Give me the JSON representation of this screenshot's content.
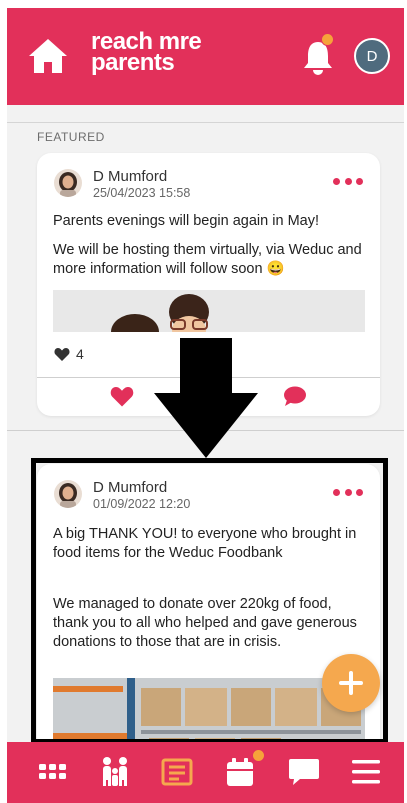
{
  "app": {
    "logo_line1": "reach m",
    "logo_line1_tail": "re",
    "logo_line2": "parents"
  },
  "header": {
    "user_initial": "D"
  },
  "feed": {
    "section_label": "FEATURED",
    "posts": [
      {
        "author": "D Mumford",
        "datetime": "25/04/2023 15:58",
        "paragraphs": [
          "Parents evenings will begin again in May!",
          "We will be hosting them virtually, via Weduc and more information will follow soon 😀"
        ],
        "likes": "4"
      },
      {
        "author": "D Mumford",
        "datetime": "01/09/2022 12:20",
        "paragraphs": [
          "A big THANK YOU! to everyone who brought in food items for the Weduc Foodbank",
          "We managed to donate over 220kg of food, thank you to all who helped and gave generous donations to those that are in crisis."
        ]
      }
    ]
  },
  "nav": {
    "items": [
      "apps-grid-icon",
      "people-icon",
      "newsfeed-icon",
      "calendar-icon",
      "messages-icon",
      "menu-icon"
    ],
    "active": "newsfeed-icon"
  },
  "colors": {
    "brand": "#e2305a",
    "accent": "#f5a84e",
    "feed_background": "#f2f2f2"
  }
}
